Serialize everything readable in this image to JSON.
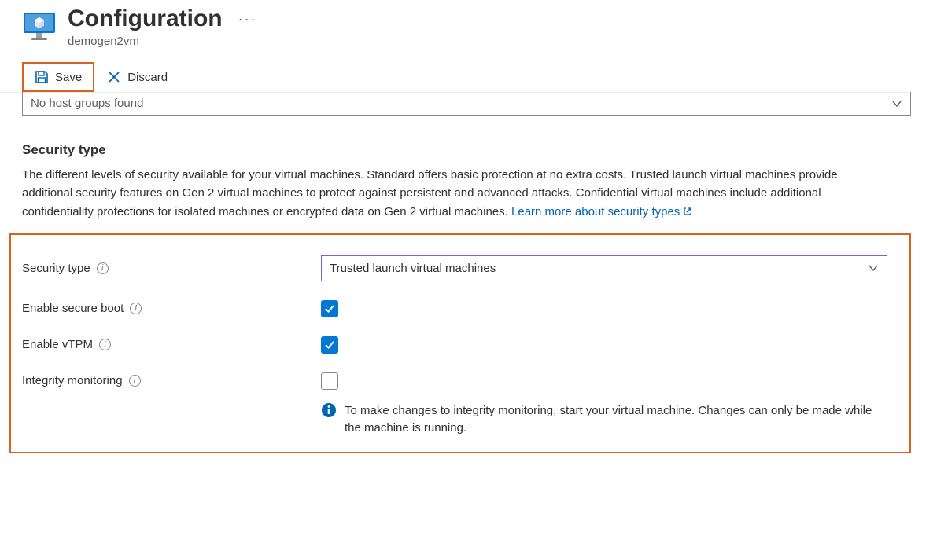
{
  "header": {
    "title": "Configuration",
    "subtitle": "demogen2vm"
  },
  "toolbar": {
    "save_label": "Save",
    "discard_label": "Discard"
  },
  "host_group": {
    "placeholder": "No host groups found"
  },
  "security": {
    "heading": "Security type",
    "description": "The different levels of security available for your virtual machines. Standard offers basic protection at no extra costs. Trusted launch virtual machines provide additional security features on Gen 2 virtual machines to protect against persistent and advanced attacks. Confidential virtual machines include additional confidentiality protections for isolated machines or encrypted data on Gen 2 virtual machines. ",
    "learn_more": "Learn more about security types",
    "fields": {
      "security_type_label": "Security type",
      "security_type_value": "Trusted launch virtual machines",
      "secure_boot_label": "Enable secure boot",
      "secure_boot_checked": true,
      "vtpm_label": "Enable vTPM",
      "vtpm_checked": true,
      "integrity_label": "Integrity monitoring",
      "integrity_checked": false
    },
    "info_note": "To make changes to integrity monitoring, start your virtual machine. Changes can only be made while the machine is running."
  }
}
